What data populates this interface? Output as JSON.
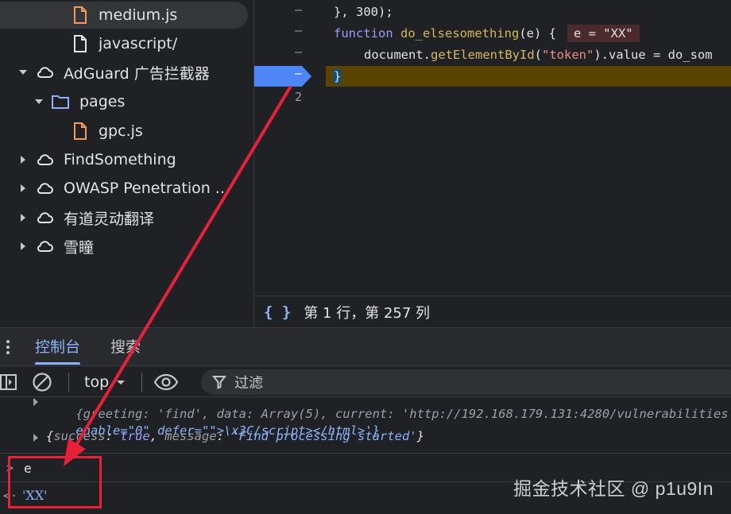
{
  "file_tree": {
    "items": [
      {
        "label": "medium.js",
        "icon": "js-file-icon",
        "expand": "none",
        "selected": true
      },
      {
        "label": "javascript/",
        "icon": "file-icon",
        "expand": "none"
      },
      {
        "label": "AdGuard 广告拦截器",
        "icon": "cloud-icon",
        "expand": "expanded"
      },
      {
        "label": "pages",
        "icon": "folder-icon",
        "expand": "expanded"
      },
      {
        "label": "gpc.js",
        "icon": "js-file-icon",
        "expand": "none"
      },
      {
        "label": "FindSomething",
        "icon": "cloud-icon",
        "expand": "collapsed"
      },
      {
        "label": "OWASP Penetration ...",
        "icon": "cloud-icon",
        "expand": "collapsed"
      },
      {
        "label": "有道灵动翻译",
        "icon": "cloud-icon",
        "expand": "collapsed"
      },
      {
        "label": "雪瞳",
        "icon": "cloud-icon",
        "expand": "collapsed"
      }
    ]
  },
  "editor": {
    "gutter": [
      "–",
      "–",
      "–",
      "–",
      "2"
    ],
    "lines": {
      "l1": "}, 300);",
      "l2_kw": "function",
      "l2_fn": "do_elsesomething",
      "l2_args": "(e) {",
      "l2_inline": "e = \"XX\"",
      "l3_obj": "document.",
      "l3_fn": "getElementById",
      "l3_open": "(",
      "l3_str": "\"token\"",
      "l3_rest": ").value = do_som",
      "l4": "}"
    },
    "status": {
      "braces": "{ }",
      "position": "第 1 行，第 257 列"
    }
  },
  "drawer": {
    "tabs": [
      {
        "label": "控制台",
        "active": true
      },
      {
        "label": "搜索",
        "active": false
      }
    ]
  },
  "toolbar": {
    "context": "top",
    "filter_label": "过滤"
  },
  "console": {
    "line1_a": "{greeting: 'find', data: Array(5), current: 'http://192.168.179.131:4280/vulnerabilities",
    "line2_a": "enable=\"0\" defer=\"\">\\x3C/script></html>'}",
    "line3_open": "{",
    "line3_k1": "success",
    "line3_colon1": ": ",
    "line3_v1": "true",
    "line3_comma": ", ",
    "line3_k2": "message",
    "line3_colon2": ": ",
    "line3_v2": "'Find processing started'",
    "line3_close": "}",
    "input_prompt": ">",
    "input": "e",
    "output_prompt": "<·",
    "output": "'XX'",
    "watermark": "掘金技术社区 @ p1u9In"
  },
  "colors": {
    "accent": "#8ab4f8",
    "annotation": "#e8203a",
    "paused_line": "#5a4500"
  }
}
